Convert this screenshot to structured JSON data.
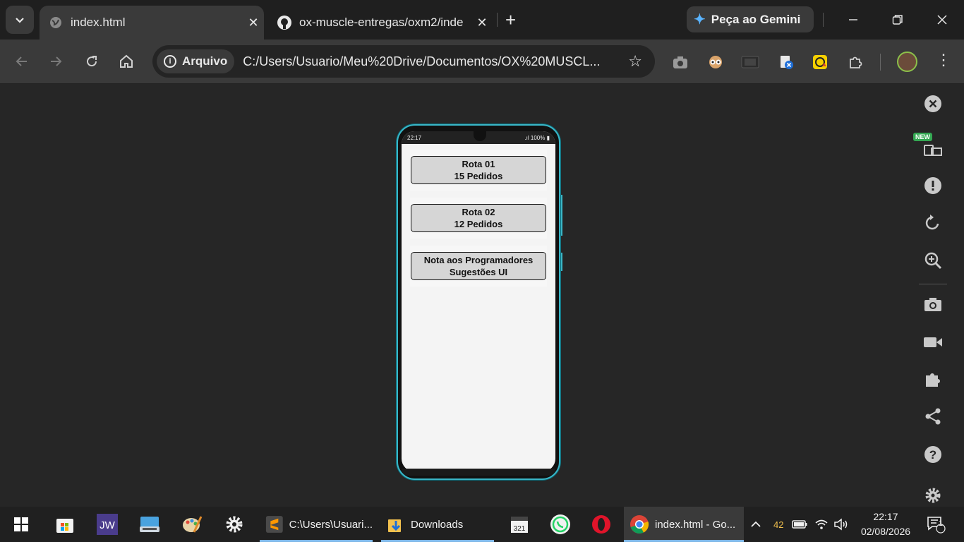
{
  "browser": {
    "tabs": [
      {
        "title": "index.html",
        "active": true
      },
      {
        "title": "ox-muscle-entregas/oxm2/inde",
        "active": false
      }
    ],
    "gemini_label": "Peça ao Gemini",
    "security_chip": "Arquivo",
    "url": "C:/Users/Usuario/Meu%20Drive/Documentos/OX%20MUSCL..."
  },
  "phone": {
    "status_time": "22:17",
    "status_battery": "100%",
    "buttons": [
      {
        "line1": "Rota 01",
        "line2": "15 Pedidos"
      },
      {
        "line1": "Rota 02",
        "line2": "12 Pedidos"
      },
      {
        "line1": "Nota aos Programadores",
        "line2": "Sugestões UI"
      }
    ]
  },
  "devtools_sidebar": {
    "new_badge": "NEW",
    "icons": [
      "close-icon",
      "device-toggle-icon",
      "alert-icon",
      "rotate-icon",
      "zoom-icon",
      "camera-icon",
      "video-icon",
      "puzzle-icon",
      "share-icon",
      "help-icon",
      "settings-icon"
    ]
  },
  "taskbar": {
    "apps": [
      {
        "label": "C:\\Users\\Usuari...",
        "icon": "sublime-icon"
      },
      {
        "label": "Downloads",
        "icon": "folder-icon"
      },
      {
        "label": "index.html - Go...",
        "icon": "chrome-icon"
      }
    ],
    "tray_temp": "42",
    "clock_time": "22:17",
    "clock_date": "02/08/2026",
    "notification_count": "1"
  },
  "colors": {
    "phone_frame": "#39b6c7",
    "button_bg": "#d6d6d6",
    "new_badge": "#34a853"
  }
}
